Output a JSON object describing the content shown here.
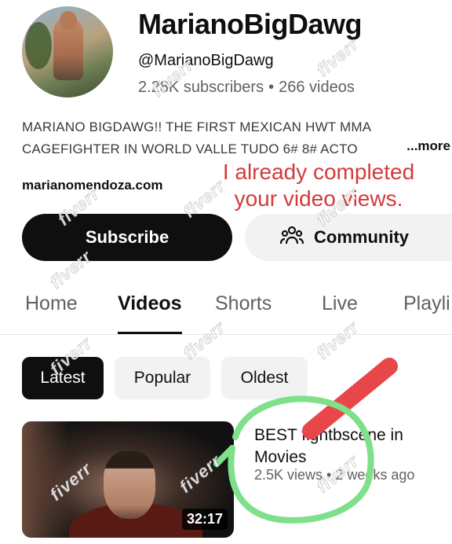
{
  "channel": {
    "name": "MarianoBigDawg",
    "handle": "@MarianoBigDawg",
    "subscribers": "2.28K subscribers",
    "separator": "•",
    "videos_count": "266 videos",
    "description_line1": "MARIANO  BIGDAWG!! THE FIRST MEXICAN  HWT MMA",
    "description_line2": "CAGEFIGHTER IN WORLD VALLE TUDO 6# 8# ACTO",
    "more_label": "...more",
    "link": "marianomendoza.com"
  },
  "annotation": {
    "note_line1": "I already completed",
    "note_line2": "your video views.",
    "note_color": "#d43a3a",
    "circle_color": "#7ee08a"
  },
  "actions": {
    "subscribe_label": "Subscribe",
    "community_label": "Community"
  },
  "tabs": [
    {
      "label": "Home"
    },
    {
      "label": "Videos"
    },
    {
      "label": "Shorts"
    },
    {
      "label": "Live"
    },
    {
      "label": "Playli"
    }
  ],
  "active_tab": "Videos",
  "chips": [
    {
      "label": "Latest",
      "selected": true
    },
    {
      "label": "Popular",
      "selected": false
    },
    {
      "label": "Oldest",
      "selected": false
    }
  ],
  "video": {
    "title_line1": "BEST fightbscene in",
    "title_line2": "Movies",
    "views": "2.5K views",
    "separator": "•",
    "age": "2 weeks ago",
    "duration": "32:17"
  },
  "watermark": "fiverr",
  "icons": {
    "community": "people-icon"
  },
  "colors": {
    "primary": "#0f0f0f",
    "secondary_text": "#606060",
    "chip_bg": "#f2f2f2"
  }
}
